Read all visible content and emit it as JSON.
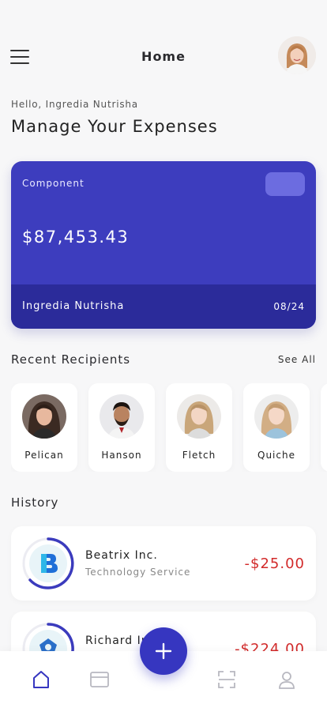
{
  "header": {
    "title": "Home",
    "menu_icon": "hamburger-menu-icon",
    "avatar": "user-avatar"
  },
  "greeting": "Hello, Ingredia Nutrisha",
  "headline": "Manage Your Expenses",
  "card": {
    "label": "Component",
    "balance": "$87,453.43",
    "holder": "Ingredia Nutrisha",
    "expiry": "08/24",
    "color": "#3d3dbe",
    "footer_color": "#2b2b9a"
  },
  "recipients": {
    "title": "Recent Recipients",
    "see_all": "See All",
    "items": [
      {
        "name": "Pelican"
      },
      {
        "name": "Hanson"
      },
      {
        "name": "Fletch"
      },
      {
        "name": "Quiche"
      }
    ]
  },
  "history": {
    "title": "History",
    "items": [
      {
        "name": "Beatrix Inc.",
        "subtitle": "Technology Service",
        "amount": "-$25.00"
      },
      {
        "name": "Richard In",
        "subtitle": "",
        "amount": "-$224.00"
      }
    ]
  },
  "nav": {
    "items": [
      "home-icon",
      "card-icon",
      "scan-icon",
      "profile-icon"
    ],
    "active": "home-icon",
    "fab_icon": "plus-icon",
    "accent": "#3636c0"
  }
}
